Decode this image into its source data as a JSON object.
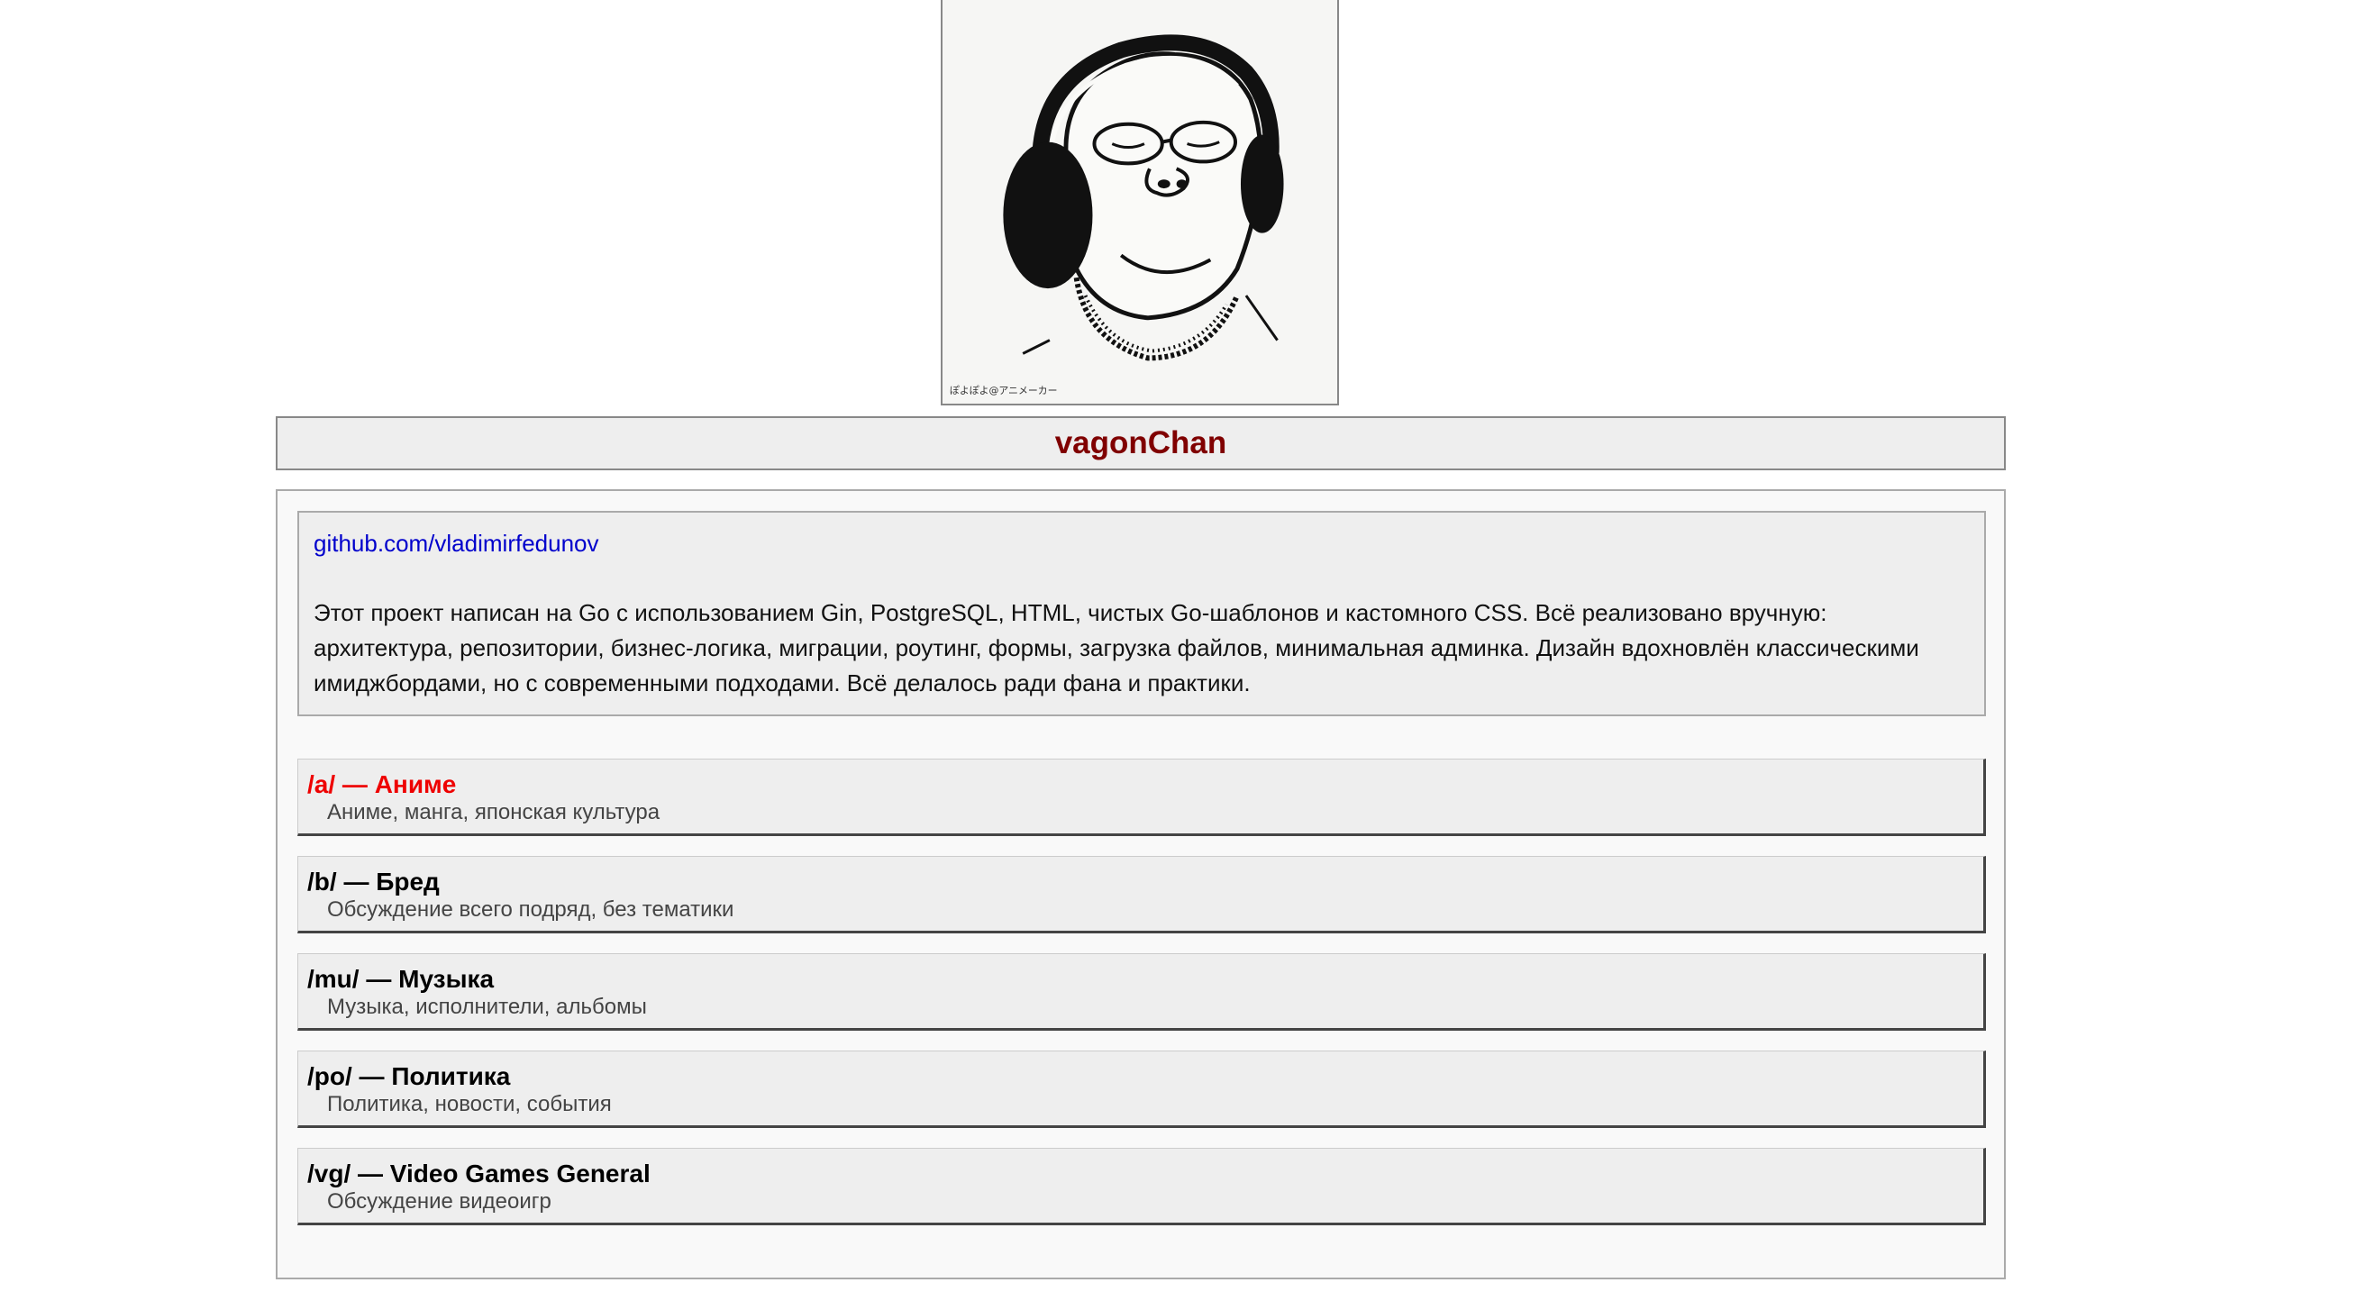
{
  "site": {
    "title": "vagonChan"
  },
  "about": {
    "link_text": "github.com/vladimirfedunov",
    "description": "Этот проект написан на Go с использованием Gin, PostgreSQL, HTML, чистых Go-шаблонов и кастомного CSS. Всё реализовано вручную: архитектура, репозитории, бизнес-логика, миграции, роутинг, формы, загрузка файлов, минимальная админка. Дизайн вдохновлён классическими имиджбордами, но с современными подходами. Всё делалось ради фана и практики."
  },
  "boards": [
    {
      "title": "/a/ — Аниме",
      "description": "Аниме, манга, японская культура",
      "active": true
    },
    {
      "title": "/b/ — Бред",
      "description": "Обсуждение всего подряд, без тематики",
      "active": false
    },
    {
      "title": "/mu/ — Музыка",
      "description": "Музыка, исполнители, альбомы",
      "active": false
    },
    {
      "title": "/po/ — Политика",
      "description": "Политика, новости, события",
      "active": false
    },
    {
      "title": "/vg/ — Video Games General",
      "description": "Обсуждение видеоигр",
      "active": false
    }
  ],
  "banner": {
    "image": "headphones-guy-illustration",
    "caption": "ぽよぽよ@アニメーカー"
  },
  "colors": {
    "title": "#800000",
    "link": "#0000cc",
    "active_board": "#ee0000",
    "panel_bg": "#eeeeee"
  }
}
